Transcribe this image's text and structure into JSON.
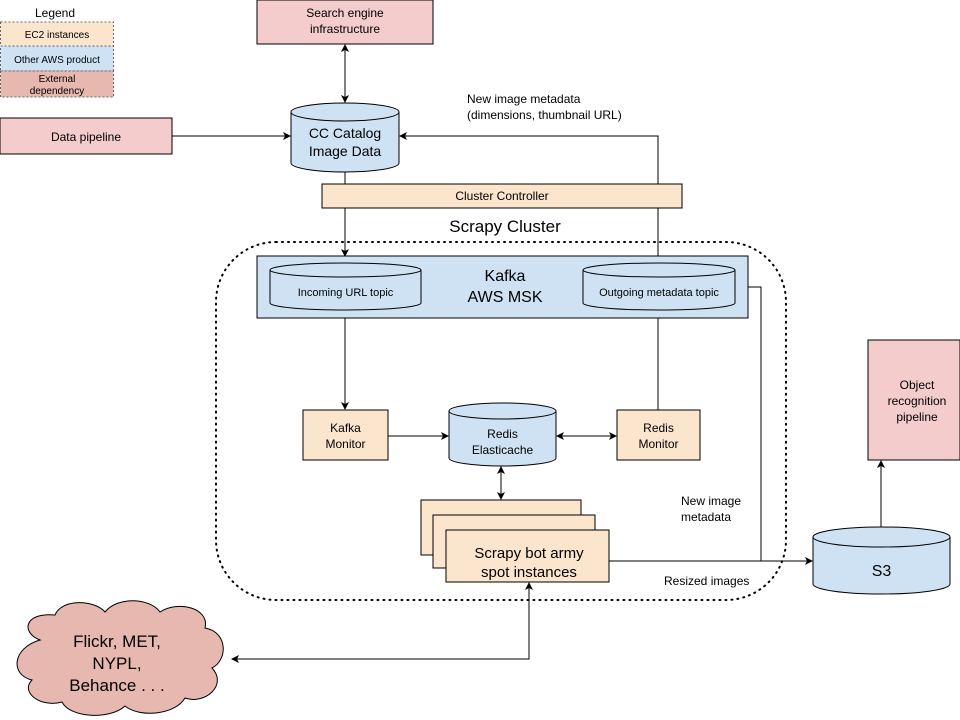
{
  "colors": {
    "ec2": "#fce5cd",
    "aws": "#cfe2f3",
    "external": "#f4cccc",
    "external_legend": "#e6b8af",
    "cloud": "#e6b8af"
  },
  "legend": {
    "title": "Legend",
    "ec2": "EC2 instances",
    "aws": "Other AWS product",
    "external": [
      "External",
      "dependency"
    ]
  },
  "nodes": {
    "search_engine": [
      "Search engine",
      "infrastructure"
    ],
    "data_pipeline": "Data pipeline",
    "cc_catalog": [
      "CC Catalog",
      "Image Data"
    ],
    "cluster_controller": "Cluster Controller",
    "scrapy_cluster": "Scrapy Cluster",
    "kafka": [
      "Kafka",
      "AWS MSK"
    ],
    "incoming_topic": "Incoming URL topic",
    "outgoing_topic": "Outgoing metadata topic",
    "kafka_monitor": [
      "Kafka",
      "Monitor"
    ],
    "redis": [
      "Redis",
      "Elasticache"
    ],
    "redis_monitor": [
      "Redis",
      "Monitor"
    ],
    "bot_army": [
      "Scrapy bot army",
      "spot instances"
    ],
    "s3": "S3",
    "object_recognition": [
      "Object",
      "recognition",
      "pipeline"
    ],
    "sources": [
      "Flickr, MET,",
      "NYPL,",
      "Behance . . ."
    ]
  },
  "labels": {
    "new_metadata_top": [
      "New image metadata",
      "(dimensions, thumbnail URL)"
    ],
    "new_metadata_right": [
      "New image",
      "metadata"
    ],
    "resized_images": "Resized images"
  }
}
